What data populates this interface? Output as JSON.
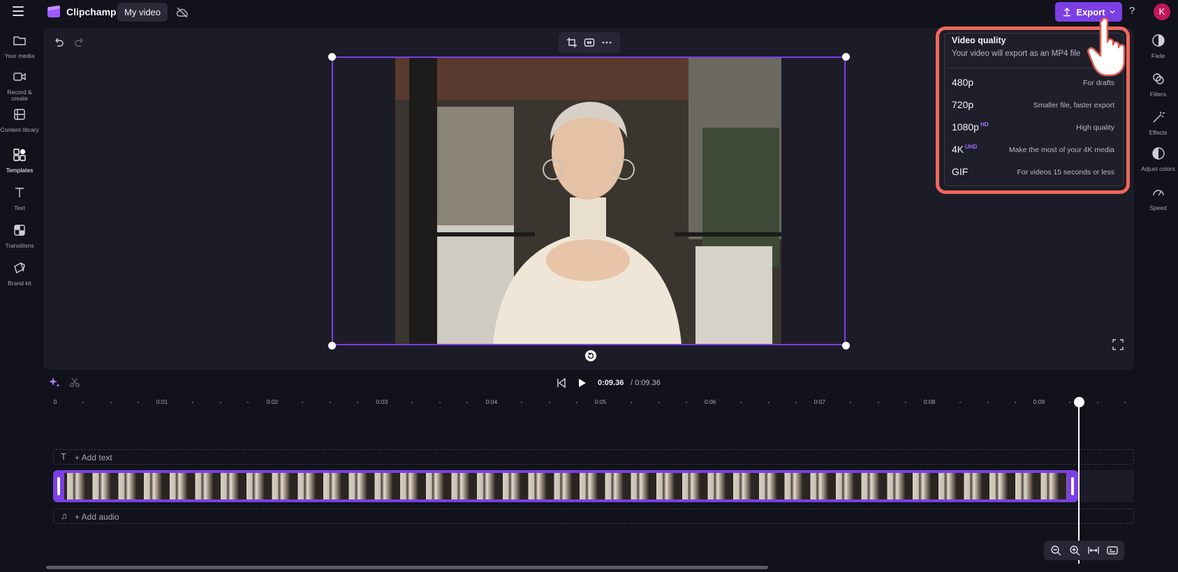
{
  "app": {
    "name": "Clipchamp",
    "project_tab": "My video"
  },
  "header": {
    "export_label": "Export",
    "help": "?",
    "avatar_letter": "K"
  },
  "left_sidebar": {
    "items": [
      {
        "label": "Your media",
        "icon": "folder-icon"
      },
      {
        "label": "Record & create",
        "icon": "camera-icon"
      },
      {
        "label": "Content library",
        "icon": "library-icon"
      },
      {
        "label": "Templates",
        "icon": "templates-icon",
        "active": true
      },
      {
        "label": "Text",
        "icon": "text-icon"
      },
      {
        "label": "Transitions",
        "icon": "transitions-icon"
      },
      {
        "label": "Brand kit",
        "icon": "brand-kit-icon"
      }
    ]
  },
  "right_sidebar": {
    "items": [
      {
        "label": "Fade",
        "icon": "fade-icon"
      },
      {
        "label": "Filters",
        "icon": "filters-icon"
      },
      {
        "label": "Effects",
        "icon": "effects-icon"
      },
      {
        "label": "Adjust colors",
        "icon": "adjust-colors-icon"
      },
      {
        "label": "Speed",
        "icon": "speed-icon"
      }
    ]
  },
  "export_menu": {
    "title": "Video quality",
    "subtitle": "Your video will export as an MP4 file",
    "options": [
      {
        "label": "480p",
        "badge": "",
        "description": "For drafts"
      },
      {
        "label": "720p",
        "badge": "",
        "description": "Smaller file, faster export"
      },
      {
        "label": "1080p",
        "badge": "HD",
        "description": "High quality"
      },
      {
        "label": "4K",
        "badge": "UHD",
        "description": "Make the most of your 4K media"
      },
      {
        "label": "GIF",
        "badge": "",
        "description": "For videos 15 seconds or less"
      }
    ]
  },
  "playback": {
    "current_time": "0:09.36",
    "total_time": "/ 0:09.36"
  },
  "ruler": {
    "labels": [
      "0",
      "0:01",
      "0:02",
      "0:03",
      "0:04",
      "0:05",
      "0:06",
      "0:07",
      "0:08",
      "0:09"
    ]
  },
  "tracks": {
    "add_text": "+ Add text",
    "add_audio": "+ Add audio"
  },
  "colors": {
    "accent": "#7b3fe4",
    "highlight": "#f0675a",
    "avatar": "#c2185b",
    "background": "#12121c"
  }
}
